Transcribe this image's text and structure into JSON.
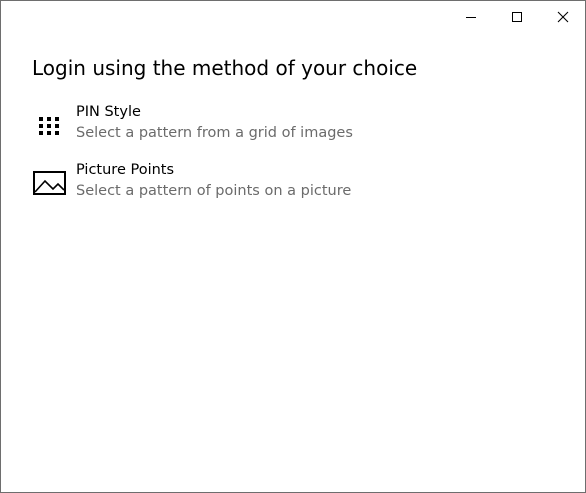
{
  "window": {
    "heading": "Login using the method of your choice"
  },
  "titlebar": {
    "icons": [
      "minimize-icon",
      "maximize-icon",
      "close-icon"
    ]
  },
  "options": [
    {
      "title": "PIN Style",
      "description": "Select a pattern from a grid of images",
      "icon": "dial-grid-icon"
    },
    {
      "title": "Picture Points",
      "description": "Select a pattern of points on a picture",
      "icon": "picture-icon"
    }
  ],
  "colors": {
    "text_primary": "#000000",
    "text_secondary": "#6b6b6b",
    "border": "#6e6e6e",
    "background": "#ffffff"
  }
}
